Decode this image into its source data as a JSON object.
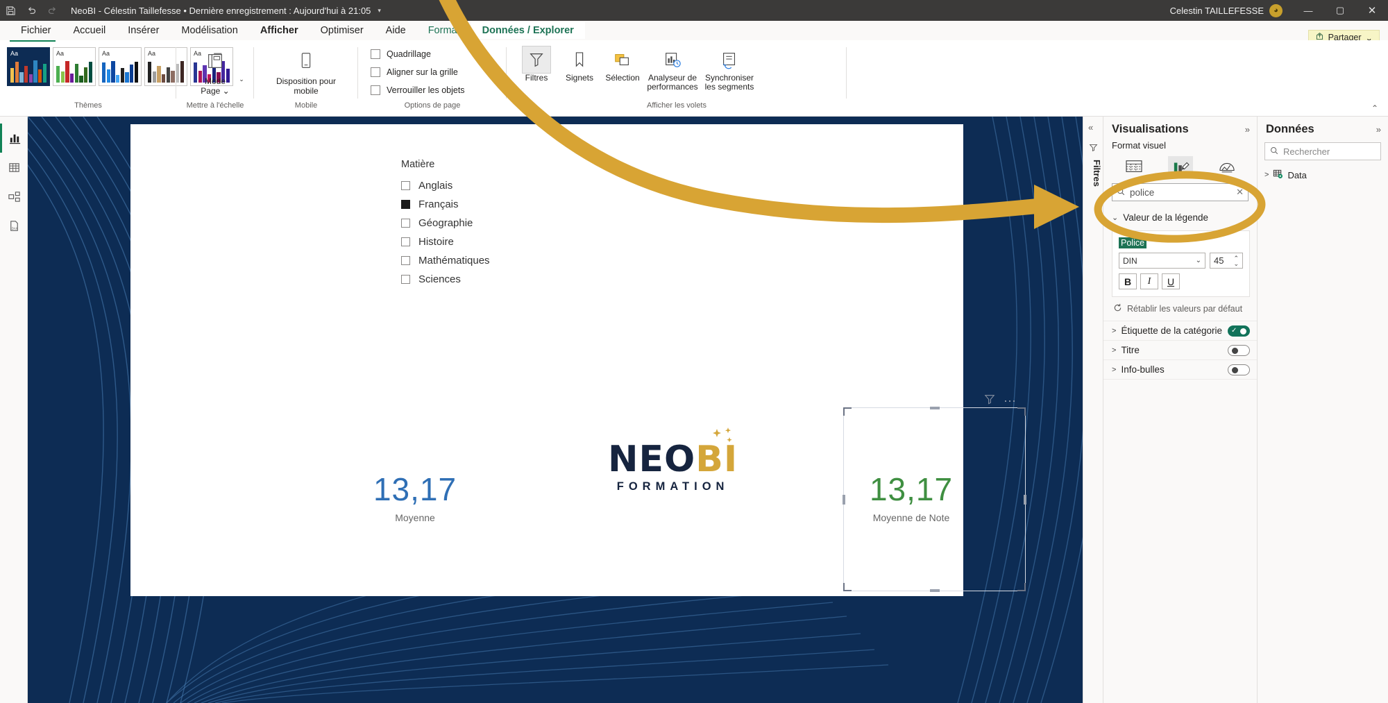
{
  "titlebar": {
    "save_icon": "save-icon",
    "undo_icon": "undo-icon",
    "redo_icon": "redo-icon",
    "title": "NeoBI - Célestin Taillefesse • Dernière enregistrement : Aujourd'hui à 21:05",
    "caret": "▾",
    "user": "Celestin TAILLEFESSE",
    "avatar_glyph": "◕",
    "minimize": "—",
    "maximize": "▢",
    "close": "✕"
  },
  "ribbon_tabs": [
    {
      "label": "Fichier",
      "state": "normal"
    },
    {
      "label": "Accueil",
      "state": "normal"
    },
    {
      "label": "Insérer",
      "state": "normal"
    },
    {
      "label": "Modélisation",
      "state": "normal"
    },
    {
      "label": "Afficher",
      "state": "active"
    },
    {
      "label": "Optimiser",
      "state": "normal"
    },
    {
      "label": "Aide",
      "state": "normal"
    },
    {
      "label": "Format",
      "state": "ctx"
    },
    {
      "label": "Données / Explorer",
      "state": "ctxsel"
    }
  ],
  "share": {
    "label": "Partager",
    "icon": "share-icon",
    "caret": "⌄"
  },
  "ribbon_groups": {
    "themes": {
      "label": "Thèmes",
      "more_caret": "⌄",
      "cards": [
        {
          "aa": "Aa",
          "selected": true,
          "colors": [
            "#f2c14e",
            "#e07b39",
            "#7fb3d5",
            "#c0392b",
            "#8e44ad",
            "#2e86c1",
            "#d35400",
            "#16a085"
          ]
        },
        {
          "aa": "Aa",
          "selected": false,
          "colors": [
            "#4caf50",
            "#8bc34a",
            "#c62828",
            "#6a1b9a",
            "#2e7d32",
            "#1b5e20",
            "#33691e",
            "#004d40"
          ]
        },
        {
          "aa": "Aa",
          "selected": false,
          "colors": [
            "#1565c0",
            "#1e88e5",
            "#0d47a1",
            "#42a5f5",
            "#212121",
            "#1976d2",
            "#0b3d91",
            "#111111"
          ]
        },
        {
          "aa": "Aa",
          "selected": false,
          "colors": [
            "#212121",
            "#9e9e9e",
            "#c8a165",
            "#6d4c41",
            "#424242",
            "#8d6e63",
            "#bdbdbd",
            "#3e2723"
          ]
        },
        {
          "aa": "Aa",
          "selected": false,
          "colors": [
            "#283593",
            "#ad1457",
            "#5e35b1",
            "#c2185b",
            "#1a237e",
            "#880e4f",
            "#4527a0",
            "#311b92"
          ]
        }
      ]
    },
    "scale": {
      "label": "Mettre à l'échelle",
      "button": {
        "line1": "Mode",
        "line2": "Page ⌄",
        "icon": "page-mode-icon"
      }
    },
    "mobile": {
      "label": "Mobile",
      "button": {
        "line1": "Disposition pour",
        "line2": "mobile",
        "icon": "mobile-layout-icon"
      }
    },
    "page_options": {
      "label": "Options de page",
      "checkboxes": [
        {
          "label": "Quadrillage",
          "checked": false
        },
        {
          "label": "Aligner sur la grille",
          "checked": false
        },
        {
          "label": "Verrouiller les objets",
          "checked": false
        }
      ]
    },
    "panes": {
      "label": "Afficher les volets",
      "buttons": [
        {
          "label": "Filtres",
          "icon": "filter-funnel-icon",
          "selected": true
        },
        {
          "label": "Signets",
          "icon": "bookmark-icon",
          "selected": false
        },
        {
          "label": "Sélection",
          "icon": "selection-pane-icon",
          "selected": false
        },
        {
          "label": "Analyseur de performances",
          "icon": "performance-analyzer-icon",
          "selected": false
        },
        {
          "label": "Synchroniser les segments",
          "icon": "sync-slicers-icon",
          "selected": false
        }
      ]
    },
    "collapse_ribbon": "⌃"
  },
  "left_rail": [
    {
      "name": "report-view-icon",
      "active": true
    },
    {
      "name": "table-view-icon",
      "active": false
    },
    {
      "name": "model-view-icon",
      "active": false
    },
    {
      "name": "dax-query-view-icon",
      "active": false
    }
  ],
  "report": {
    "slicer": {
      "title": "Matière",
      "items": [
        {
          "label": "Anglais",
          "checked": false
        },
        {
          "label": "Français",
          "checked": true
        },
        {
          "label": "Géographie",
          "checked": false
        },
        {
          "label": "Histoire",
          "checked": false
        },
        {
          "label": "Mathématiques",
          "checked": false
        },
        {
          "label": "Sciences",
          "checked": false
        }
      ]
    },
    "kpi_left": {
      "value": "13,17",
      "caption": "Moyenne",
      "color": "#2f6fb5"
    },
    "kpi_right": {
      "value": "13,17",
      "caption": "Moyenne de Note",
      "color": "#3f8f41"
    },
    "visual_icons": {
      "filter": "filter-funnel-icon",
      "more": "more-options-icon"
    },
    "logo": {
      "part1": "NEO",
      "part2": "BI",
      "subtitle": "FORMATION",
      "sparkle": "✦",
      "dark_color": "#16243f",
      "gold_color": "#d4a63a"
    }
  },
  "filters_strip": {
    "collapse": "«",
    "label": "Filtres",
    "icon": "filter-funnel-icon"
  },
  "visualizations_pane": {
    "title": "Visualisations",
    "expand": "»",
    "subtitle": "Format visuel",
    "format_tabs": [
      {
        "name": "build-visual-icon",
        "selected": false
      },
      {
        "name": "format-visual-icon",
        "selected": true
      },
      {
        "name": "analytics-icon",
        "selected": false
      }
    ],
    "search": {
      "value": "police",
      "icon": "search-icon",
      "clear": "✕"
    },
    "legend_section": {
      "label": "Valeur de la légende",
      "chevron": "⌄"
    },
    "font_card": {
      "label": "Police",
      "family": "DIN",
      "family_caret": "⌄",
      "size": "45",
      "bold": "B",
      "italic": "I",
      "underline": "U"
    },
    "reset": {
      "label": "Rétablir les valeurs par défaut",
      "icon": "reset-icon"
    },
    "sections": [
      {
        "label": "Étiquette de la catégorie",
        "chevron": ">",
        "toggle": "on"
      },
      {
        "label": "Titre",
        "chevron": ">",
        "toggle": "off"
      },
      {
        "label": "Info-bulles",
        "chevron": ">",
        "toggle": "off"
      }
    ]
  },
  "data_pane": {
    "title": "Données",
    "expand": "»",
    "search_placeholder": "Rechercher",
    "search_icon": "search-icon",
    "tree": [
      {
        "label": "Data",
        "chevron": ">",
        "icon": "table-icon"
      }
    ]
  },
  "annotation": {
    "arrow_color": "#d8a434",
    "ellipse_color": "#d8a434",
    "target": "search-input"
  }
}
